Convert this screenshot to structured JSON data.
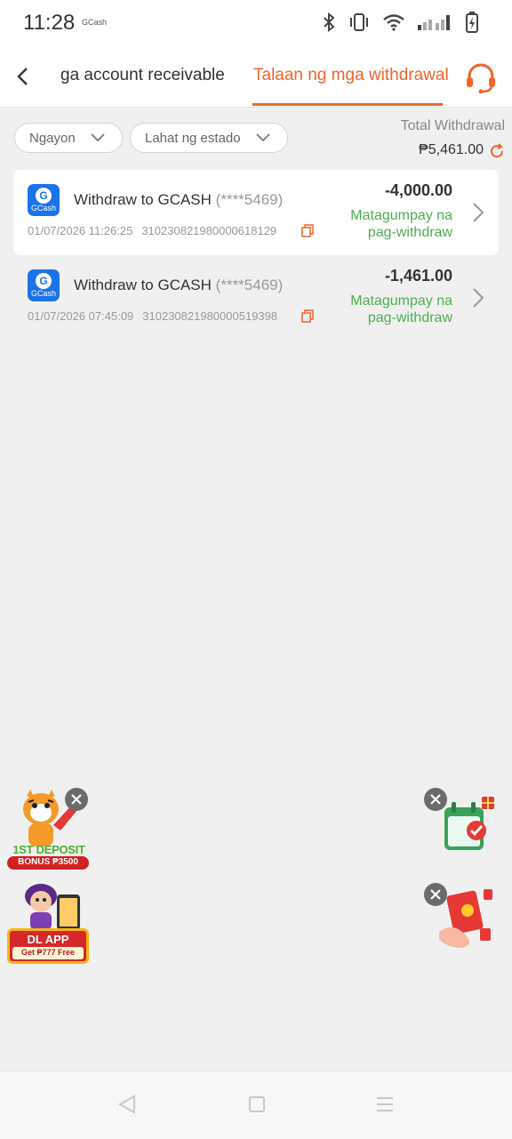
{
  "status_bar": {
    "time": "11:28",
    "app_label": "GCash",
    "icons": [
      "bluetooth-icon",
      "vibrate-icon",
      "wifi-icon",
      "signal-icon",
      "battery-charging-icon"
    ]
  },
  "header": {
    "tabs": [
      {
        "label": "ga account receivable",
        "active": false
      },
      {
        "label": "Talaan ng mga withdrawal",
        "active": true
      }
    ],
    "accent_color": "#f0642a"
  },
  "filters": {
    "date_filter": "Ngayon",
    "status_filter": "Lahat ng estado"
  },
  "summary": {
    "label": "Total Withdrawal",
    "amount": "₱5,461.00"
  },
  "records": [
    {
      "method_logo_text": "GCash",
      "title": "Withdraw to GCASH",
      "account": "(****5469)",
      "datetime": "01/07/2026 11:26:25",
      "reference": "3102308219800006181​29",
      "amount": "-4,000.00",
      "status": "Matagumpay na pag-withdraw"
    },
    {
      "method_logo_text": "GCash",
      "title": "Withdraw to GCASH",
      "account": "(****5469)",
      "datetime": "01/07/2026 07:45:09",
      "reference": "310230821980000519398",
      "amount": "-1,461.00",
      "status": "Matagumpay na pag-withdraw"
    }
  ],
  "promos": {
    "first_deposit": {
      "title": "1ST DEPOSIT",
      "bonus": "BONUS ₱3500"
    },
    "dl_app": {
      "title": "DL APP",
      "subtitle": "Get ₱777 Free"
    }
  },
  "status_color": "#4caf50"
}
